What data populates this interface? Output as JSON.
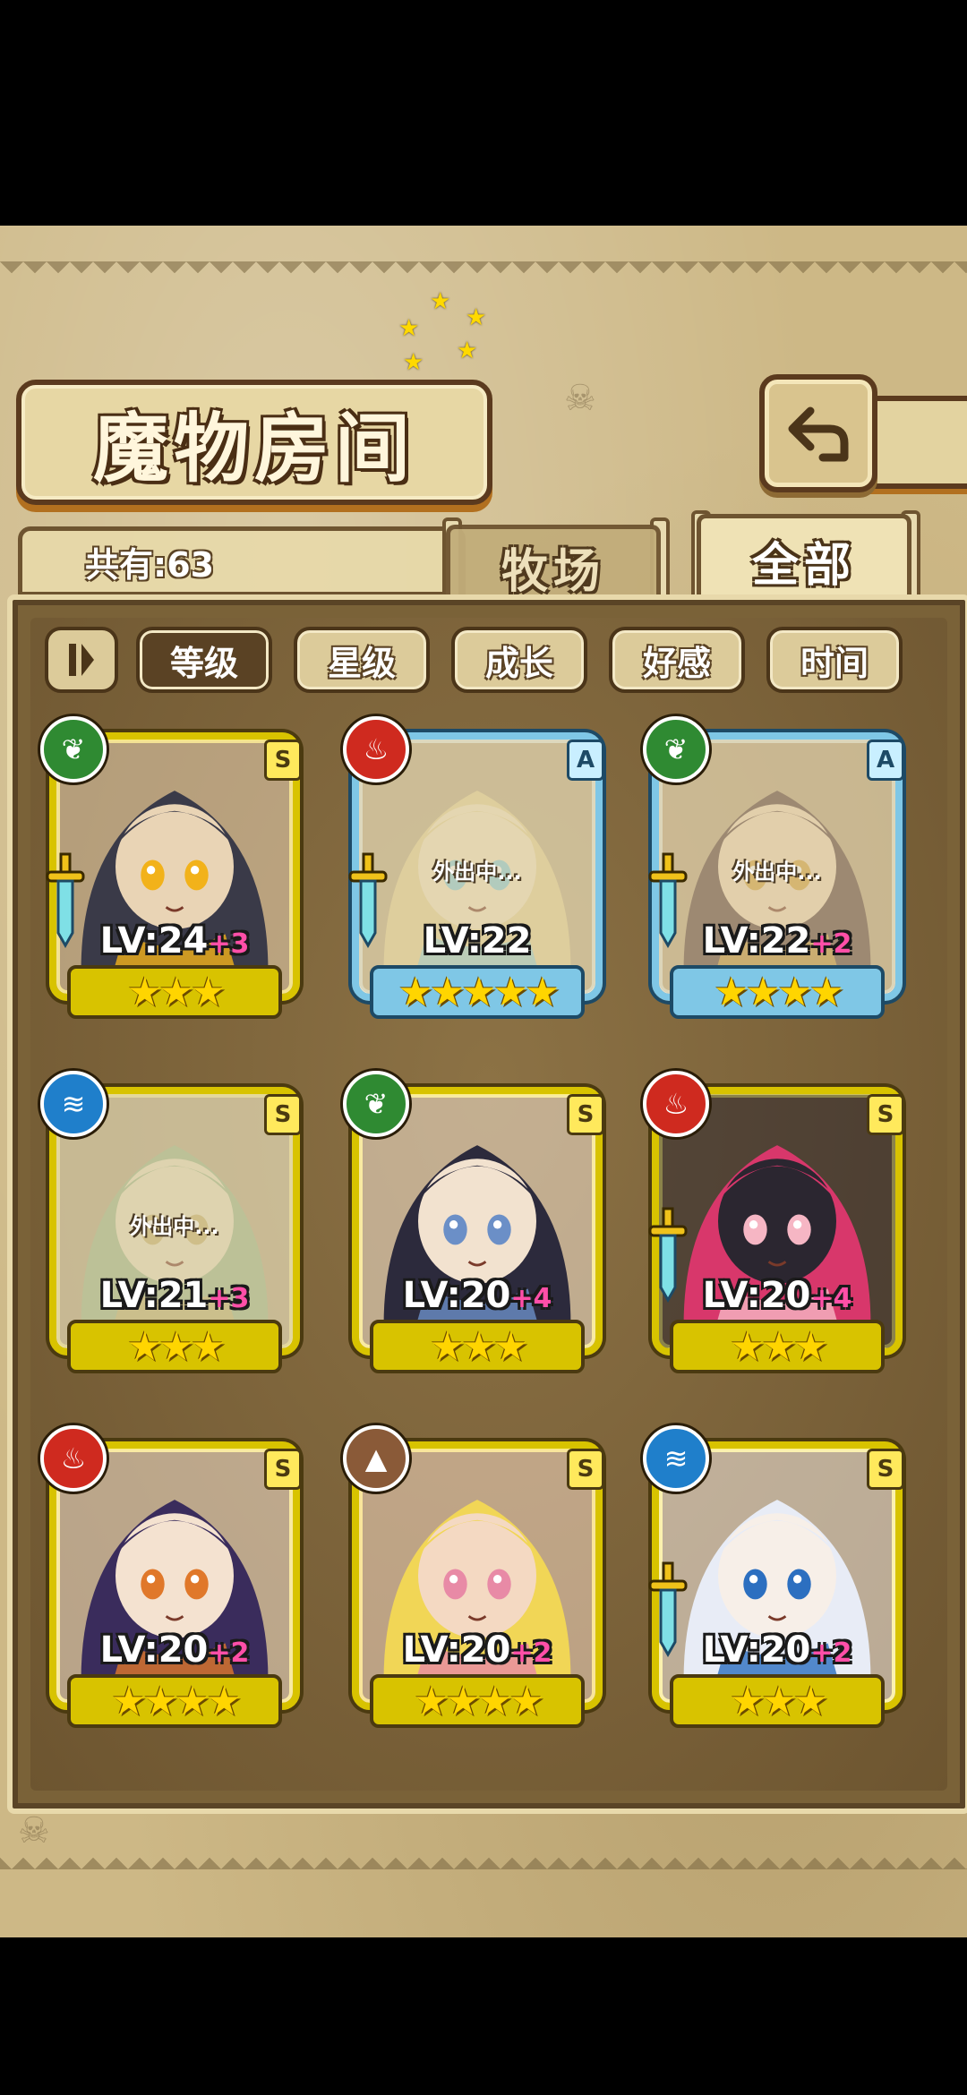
{
  "header": {
    "title": "魔物房间",
    "back_icon": "back-arrow-icon"
  },
  "count": {
    "label": "共有:63"
  },
  "tabs": [
    {
      "label": "牧场",
      "active": false
    },
    {
      "label": "全部",
      "active": true
    }
  ],
  "sort": {
    "toggle_icon": "pause-sort-icon",
    "options": [
      {
        "label": "等级",
        "active": true
      },
      {
        "label": "星级",
        "active": false
      },
      {
        "label": "成长",
        "active": false
      },
      {
        "label": "好感",
        "active": false
      },
      {
        "label": "时间",
        "active": false
      }
    ]
  },
  "away_label": "外出中...",
  "monsters": [
    {
      "element": "wood",
      "element_icon": "leaf-icon",
      "rank": "S",
      "level": "LV:24",
      "plus": "+3",
      "stars": 3,
      "away": false,
      "weapon": true,
      "colors": [
        "#3a3a48",
        "#e9d4b5",
        "#f2b21a"
      ]
    },
    {
      "element": "fire",
      "element_icon": "flame-icon",
      "rank": "A",
      "level": "LV:22",
      "plus": "",
      "stars": 5,
      "away": true,
      "weapon": true,
      "colors": [
        "#e8d59a",
        "#f6e7c6",
        "#88cfe0"
      ]
    },
    {
      "element": "wood",
      "element_icon": "leaf-icon",
      "rank": "A",
      "level": "LV:22",
      "plus": "+2",
      "stars": 4,
      "away": true,
      "weapon": true,
      "colors": [
        "#5a3d3a",
        "#f1d8b8",
        "#d6a13a"
      ]
    },
    {
      "element": "water",
      "element_icon": "wave-icon",
      "rank": "S",
      "level": "LV:21",
      "plus": "+3",
      "stars": 3,
      "away": true,
      "weapon": false,
      "colors": [
        "#9eb88c",
        "#e9e0c2",
        "#c7b26d"
      ]
    },
    {
      "element": "wood",
      "element_icon": "leaf-icon",
      "rank": "S",
      "level": "LV:20",
      "plus": "+4",
      "stars": 3,
      "away": false,
      "weapon": false,
      "colors": [
        "#2c2a3c",
        "#f2e2cf",
        "#6b8fc7"
      ]
    },
    {
      "element": "fire",
      "element_icon": "flame-icon",
      "rank": "S",
      "level": "LV:20",
      "plus": "+4",
      "stars": 3,
      "away": false,
      "weapon": true,
      "colors": [
        "#d8376b",
        "#2b2630",
        "#f6b6c4"
      ]
    },
    {
      "element": "fire",
      "element_icon": "flame-icon",
      "rank": "S",
      "level": "LV:20",
      "plus": "+2",
      "stars": 4,
      "away": false,
      "weapon": false,
      "colors": [
        "#3a2c5c",
        "#f4e2d0",
        "#e0782a"
      ]
    },
    {
      "element": "earth",
      "element_icon": "mountain-icon",
      "rank": "S",
      "level": "LV:20",
      "plus": "+2",
      "stars": 4,
      "away": false,
      "weapon": false,
      "colors": [
        "#f1d656",
        "#f4d9c2",
        "#e88aa6"
      ]
    },
    {
      "element": "water",
      "element_icon": "wave-icon",
      "rank": "S",
      "level": "LV:20",
      "plus": "+2",
      "stars": 3,
      "away": false,
      "weapon": true,
      "colors": [
        "#e8ecf6",
        "#f7efe8",
        "#2c6fc0"
      ]
    }
  ]
}
